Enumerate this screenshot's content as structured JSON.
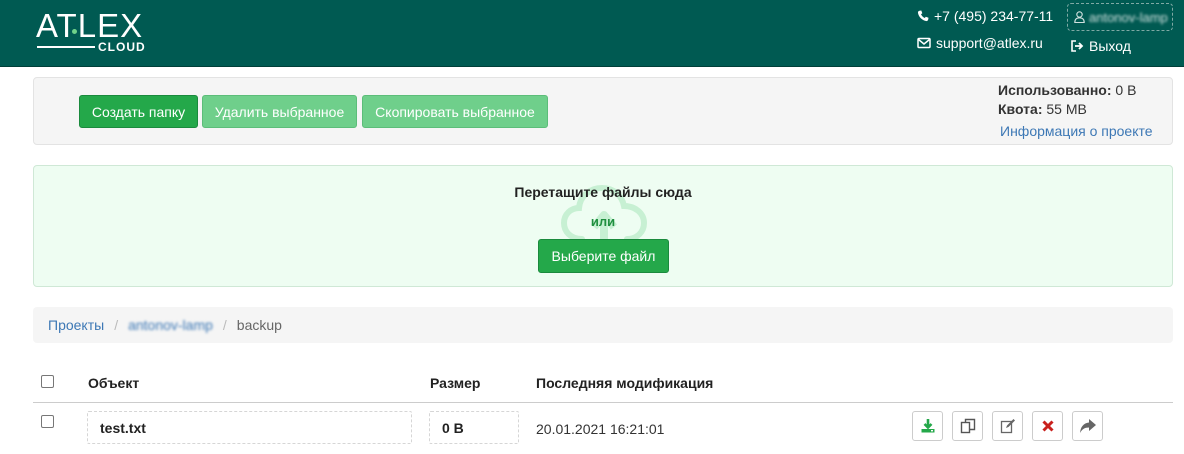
{
  "header": {
    "logo_main": "ATLEX",
    "logo_sub": "CLOUD",
    "phone": "+7 (495) 234-77-11",
    "email": "support@atlex.ru",
    "user": "antonov-lamp",
    "logout": "Выход"
  },
  "toolbar": {
    "create_folder": "Создать папку",
    "delete_selected": "Удалить выбранное",
    "copy_selected": "Скопировать выбранное",
    "used_label": "Использованно:",
    "used_value": "0 B",
    "quota_label": "Квота:",
    "quota_value": "55 MB",
    "project_info": "Информация о проекте"
  },
  "dropzone": {
    "title": "Перетащите файлы сюда",
    "or": "или",
    "choose_file": "Выберите файл"
  },
  "breadcrumb": {
    "items": [
      "Проекты",
      "antonov-lamp",
      "backup"
    ]
  },
  "table": {
    "headers": [
      "Объект",
      "Размер",
      "Последняя модификация"
    ],
    "rows": [
      {
        "name": "test.txt",
        "size": "0 B",
        "modified": "20.01.2021 16:21:01"
      }
    ]
  },
  "colors": {
    "header_bg": "#005a52",
    "primary_green": "#24a84a",
    "disabled_green": "#6fcf8b",
    "link_blue": "#3d78b5",
    "dropzone_bg": "#eefdf2"
  },
  "icons": {
    "phone": "phone-icon",
    "mail": "envelope-icon",
    "user": "user-icon",
    "logout": "sign-out-icon",
    "upload": "cloud-upload-icon",
    "actions": [
      "download-icon",
      "copy-icon",
      "edit-icon",
      "delete-icon",
      "share-icon"
    ]
  }
}
